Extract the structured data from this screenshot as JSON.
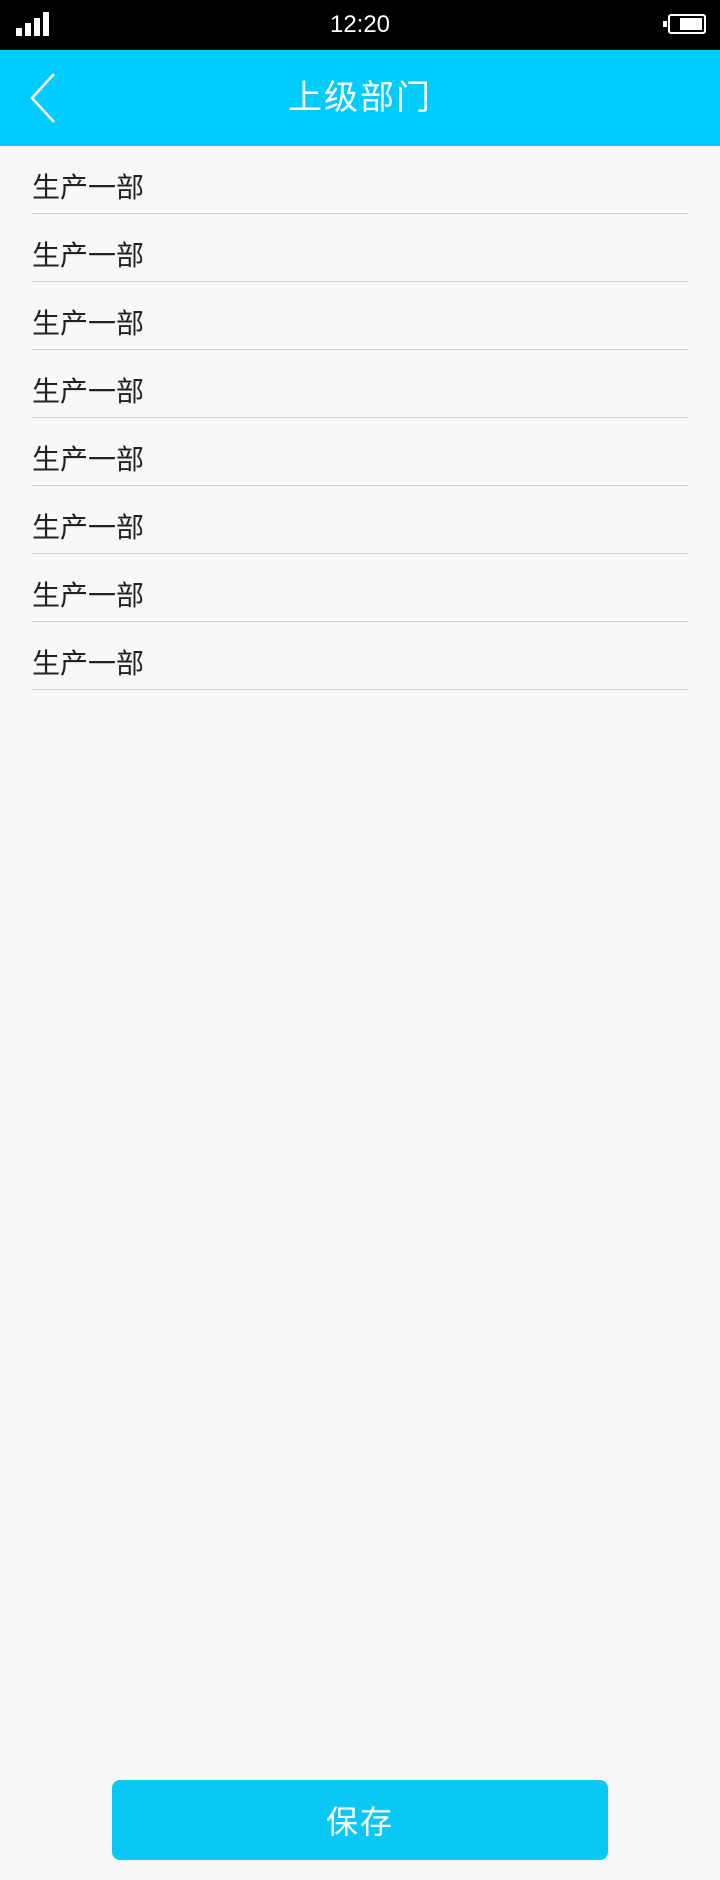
{
  "status_bar": {
    "time": "12:20",
    "signal_icon": "signal-strength-icon",
    "battery_icon": "battery-icon"
  },
  "header": {
    "title": "上级部门",
    "back_icon": "chevron-left-icon",
    "background_color": "#00ccff"
  },
  "departments": [
    {
      "label": "生产一部"
    },
    {
      "label": "生产一部"
    },
    {
      "label": "生产一部"
    },
    {
      "label": "生产一部"
    },
    {
      "label": "生产一部"
    },
    {
      "label": "生产一部"
    },
    {
      "label": "生产一部"
    },
    {
      "label": "生产一部"
    }
  ],
  "footer": {
    "save_label": "保存",
    "button_color": "#0ac8f6"
  }
}
